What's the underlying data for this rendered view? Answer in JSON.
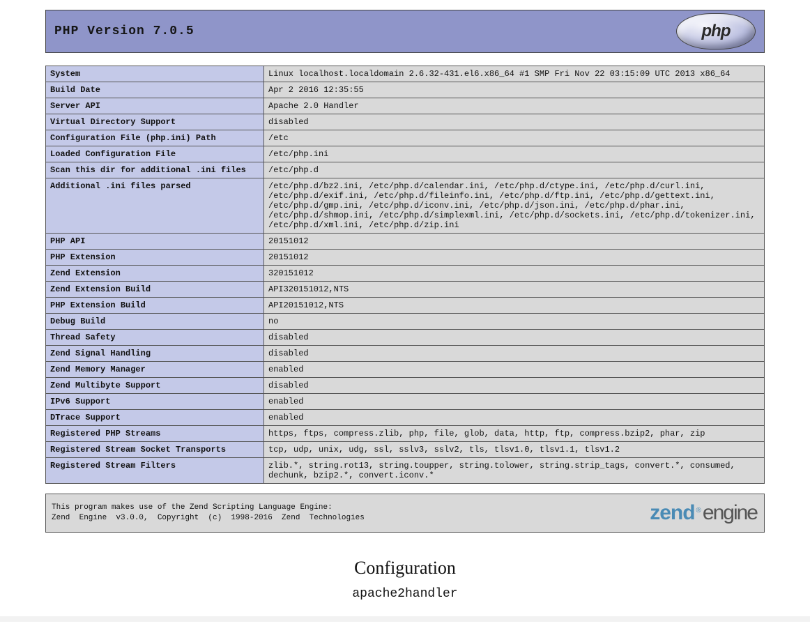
{
  "header": {
    "title": "PHP Version 7.0.5",
    "logo_text": "php"
  },
  "info_rows": [
    {
      "k": "System",
      "v": "Linux localhost.localdomain 2.6.32-431.el6.x86_64 #1 SMP Fri Nov 22 03:15:09 UTC 2013 x86_64"
    },
    {
      "k": "Build Date",
      "v": "Apr 2 2016 12:35:55"
    },
    {
      "k": "Server API",
      "v": "Apache 2.0 Handler"
    },
    {
      "k": "Virtual Directory Support",
      "v": "disabled"
    },
    {
      "k": "Configuration File (php.ini) Path",
      "v": "/etc"
    },
    {
      "k": "Loaded Configuration File",
      "v": "/etc/php.ini"
    },
    {
      "k": "Scan this dir for additional .ini files",
      "v": "/etc/php.d"
    },
    {
      "k": "Additional .ini files parsed",
      "v": "/etc/php.d/bz2.ini, /etc/php.d/calendar.ini, /etc/php.d/ctype.ini, /etc/php.d/curl.ini, /etc/php.d/exif.ini, /etc/php.d/fileinfo.ini, /etc/php.d/ftp.ini, /etc/php.d/gettext.ini, /etc/php.d/gmp.ini, /etc/php.d/iconv.ini, /etc/php.d/json.ini, /etc/php.d/phar.ini, /etc/php.d/shmop.ini, /etc/php.d/simplexml.ini, /etc/php.d/sockets.ini, /etc/php.d/tokenizer.ini, /etc/php.d/xml.ini, /etc/php.d/zip.ini"
    },
    {
      "k": "PHP API",
      "v": "20151012"
    },
    {
      "k": "PHP Extension",
      "v": "20151012"
    },
    {
      "k": "Zend Extension",
      "v": "320151012"
    },
    {
      "k": "Zend Extension Build",
      "v": "API320151012,NTS"
    },
    {
      "k": "PHP Extension Build",
      "v": "API20151012,NTS"
    },
    {
      "k": "Debug Build",
      "v": "no"
    },
    {
      "k": "Thread Safety",
      "v": "disabled"
    },
    {
      "k": "Zend Signal Handling",
      "v": "disabled"
    },
    {
      "k": "Zend Memory Manager",
      "v": "enabled"
    },
    {
      "k": "Zend Multibyte Support",
      "v": "disabled"
    },
    {
      "k": "IPv6 Support",
      "v": "enabled"
    },
    {
      "k": "DTrace Support",
      "v": "enabled"
    },
    {
      "k": "Registered PHP Streams",
      "v": "https, ftps, compress.zlib, php, file, glob, data, http, ftp, compress.bzip2, phar, zip"
    },
    {
      "k": "Registered Stream Socket Transports",
      "v": "tcp, udp, unix, udg, ssl, sslv3, sslv2, tls, tlsv1.0, tlsv1.1, tlsv1.2"
    },
    {
      "k": "Registered Stream Filters",
      "v": "zlib.*, string.rot13, string.toupper, string.tolower, string.strip_tags, convert.*, consumed, dechunk, bzip2.*, convert.iconv.*"
    }
  ],
  "zend": {
    "line1": "This program makes use of the Zend Scripting Language Engine:",
    "line2": "Zend  Engine  v3.0.0,  Copyright  (c)  1998-2016  Zend  Technologies",
    "logo_zend": "zend",
    "logo_engine": "engine"
  },
  "config_heading": "Configuration",
  "section_heading": "apache2handler"
}
